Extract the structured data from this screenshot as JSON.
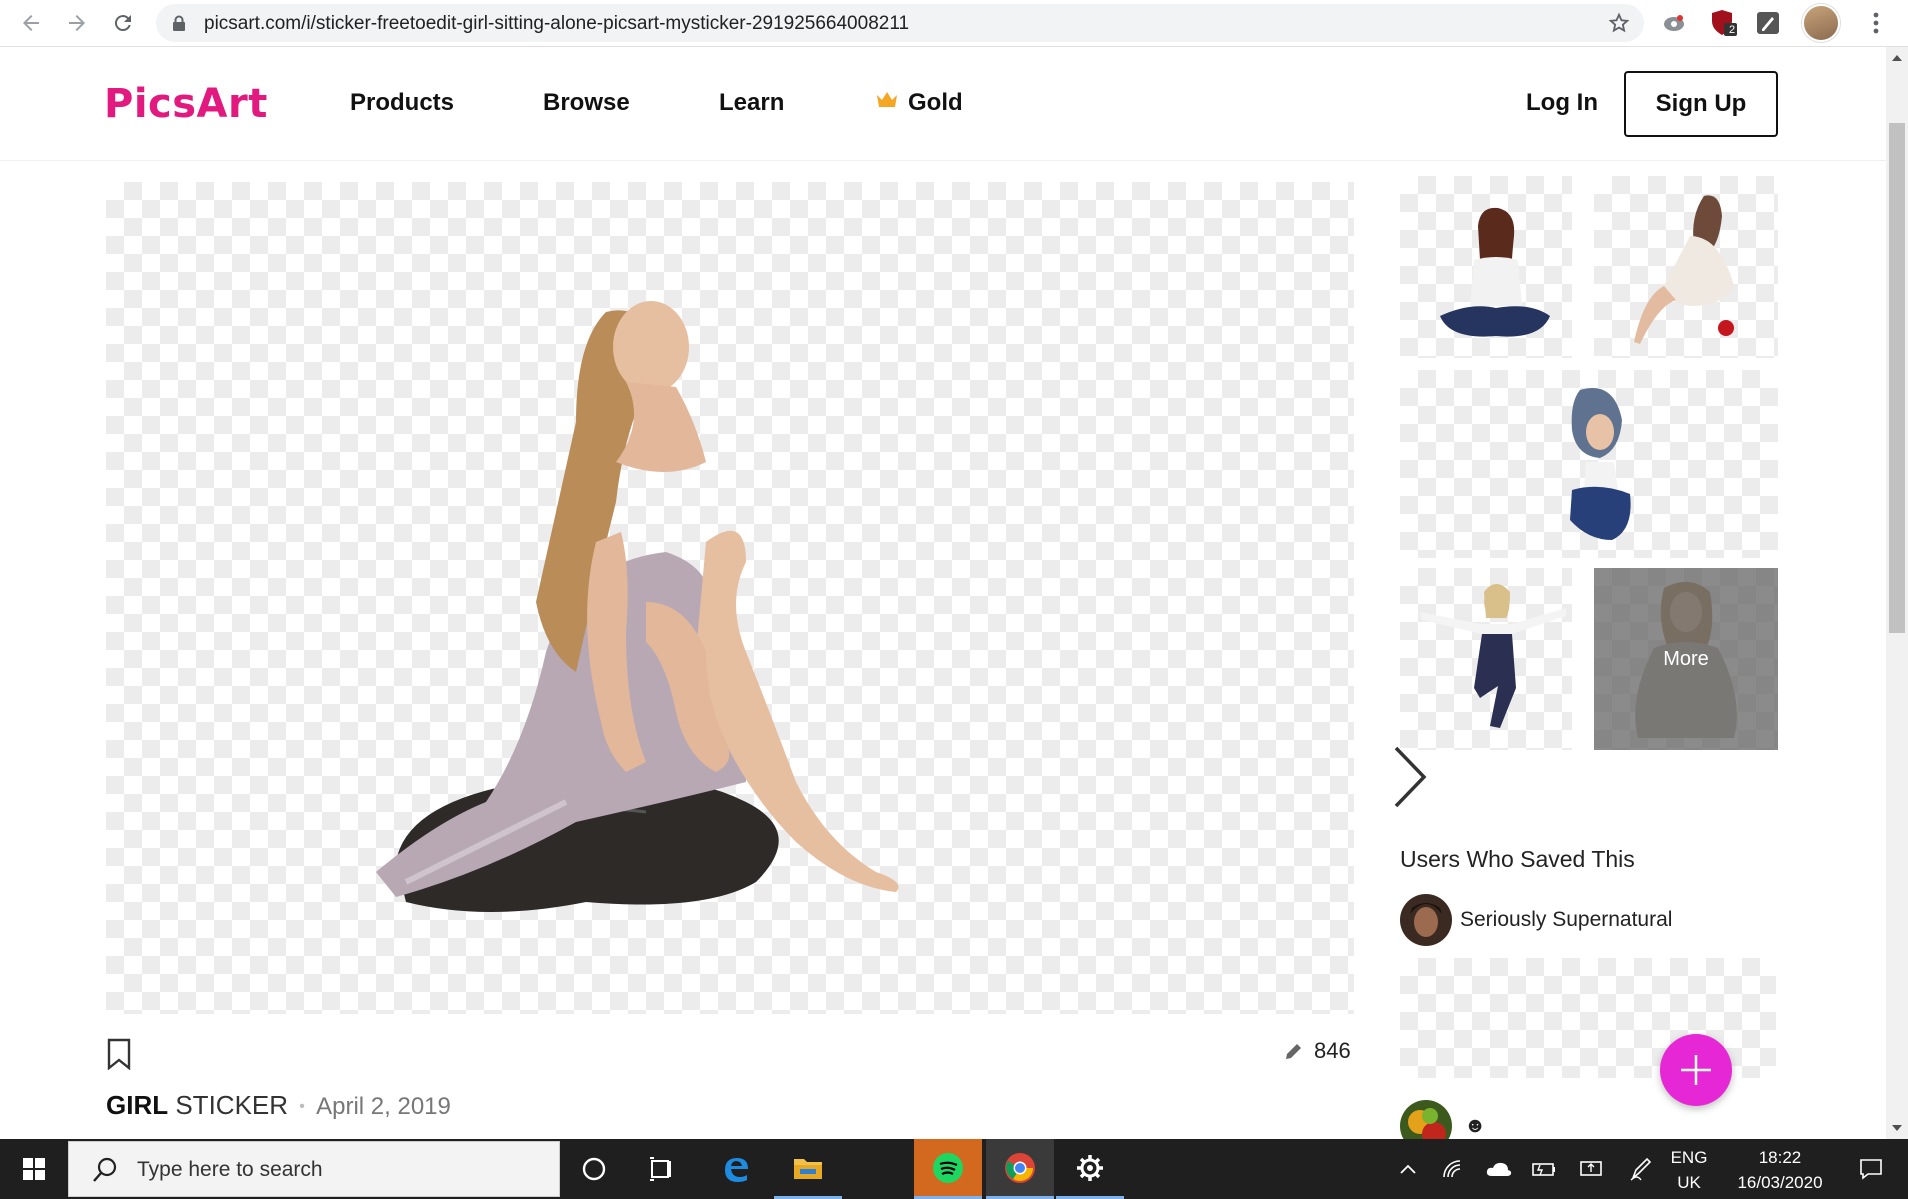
{
  "browser": {
    "url": "picsart.com/i/sticker-freetoedit-girl-sitting-alone-picsart-mysticker-291925664008211",
    "extension_badge": "2"
  },
  "header": {
    "logo": "PicsArt",
    "nav": [
      "Products",
      "Browse",
      "Learn",
      "Gold"
    ],
    "login": "Log In",
    "signup": "Sign Up"
  },
  "main": {
    "edit_count": "846",
    "tag": "GIRL",
    "type": "STICKER",
    "separator": "•",
    "date": "April 2, 2019"
  },
  "sidebar": {
    "more_label": "More",
    "saved_title": "Users Who Saved This",
    "users": [
      {
        "name": "Seriously Supernatural"
      },
      {
        "name": "☻"
      }
    ]
  },
  "taskbar": {
    "search_placeholder": "Type here to search",
    "lang_top": "ENG",
    "lang_bottom": "UK",
    "time": "18:22",
    "date": "16/03/2020"
  },
  "colors": {
    "brand": "#e2197f",
    "fab": "#e627d6",
    "gold": "#f5a623"
  }
}
